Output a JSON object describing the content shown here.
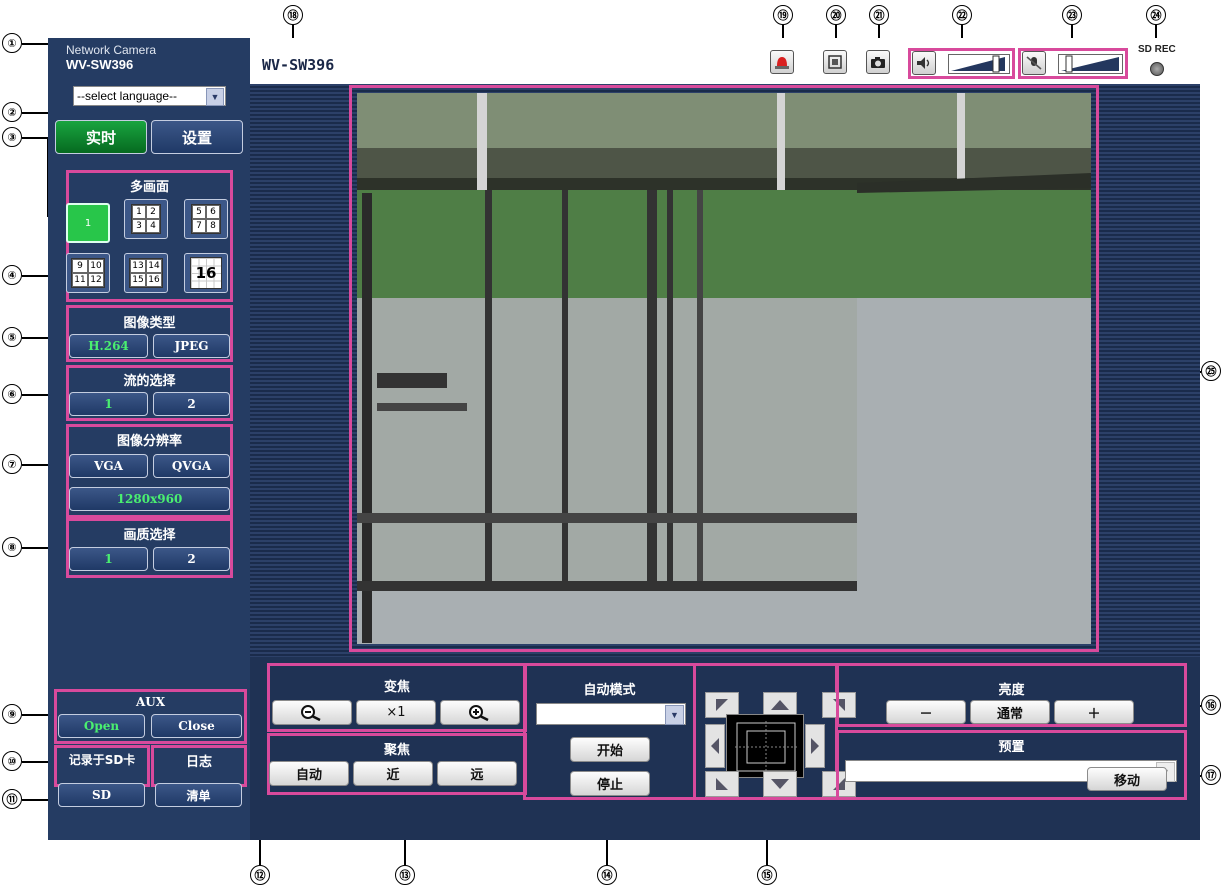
{
  "app": {
    "brand": "Network Camera",
    "model": "WV-SW396",
    "title": "WV-SW396",
    "sd_rec": "SD REC"
  },
  "language_select": {
    "value": "--select language--"
  },
  "mode_tabs": {
    "live": "实时",
    "setup": "设置"
  },
  "multiscreen": {
    "title": "多画面",
    "layouts": [
      {
        "label": "1"
      },
      {
        "cells": [
          "1",
          "2",
          "3",
          "4"
        ]
      },
      {
        "cells": [
          "5",
          "6",
          "7",
          "8"
        ]
      },
      {
        "cells": [
          "9",
          "10",
          "11",
          "12"
        ]
      },
      {
        "cells": [
          "13",
          "14",
          "15",
          "16"
        ]
      },
      {
        "label": "16"
      }
    ]
  },
  "image_type": {
    "title": "图像类型",
    "h264": "H.264",
    "jpeg": "JPEG"
  },
  "stream": {
    "title": "流的选择",
    "s1": "1",
    "s2": "2"
  },
  "resolution": {
    "title": "图像分辨率",
    "vga": "VGA",
    "qvga": "QVGA",
    "hd": "1280x960"
  },
  "quality": {
    "title": "画质选择",
    "q1": "1",
    "q2": "2"
  },
  "aux": {
    "title": "AUX",
    "open": "Open",
    "close": "Close"
  },
  "sd": {
    "title": "记录于SD卡",
    "button": "SD"
  },
  "log": {
    "title": "日志",
    "button": "清单"
  },
  "zoom": {
    "title": "变焦",
    "x1": "×1"
  },
  "focus": {
    "title": "聚焦",
    "auto": "自动",
    "near": "近",
    "far": "远"
  },
  "auto_mode": {
    "title": "自动模式",
    "value": "",
    "start": "开始",
    "stop": "停止"
  },
  "brightness": {
    "title": "亮度",
    "minus": "－",
    "normal": "通常",
    "plus": "＋"
  },
  "preset": {
    "title": "预置",
    "value": "",
    "move": "移动"
  },
  "callouts": [
    "①",
    "②",
    "③",
    "④",
    "⑤",
    "⑥",
    "⑦",
    "⑧",
    "⑨",
    "⑩",
    "⑪",
    "⑫",
    "⑬",
    "⑭",
    "⑮",
    "⑯",
    "⑰",
    "⑱",
    "⑲",
    "⑳",
    "㉑",
    "㉒",
    "㉓",
    "㉔",
    "㉕"
  ],
  "colors": {
    "panel": "#253c63",
    "accent": "#d84a9c",
    "live_green": "#0a8a2c",
    "on_text": "#4af070"
  }
}
